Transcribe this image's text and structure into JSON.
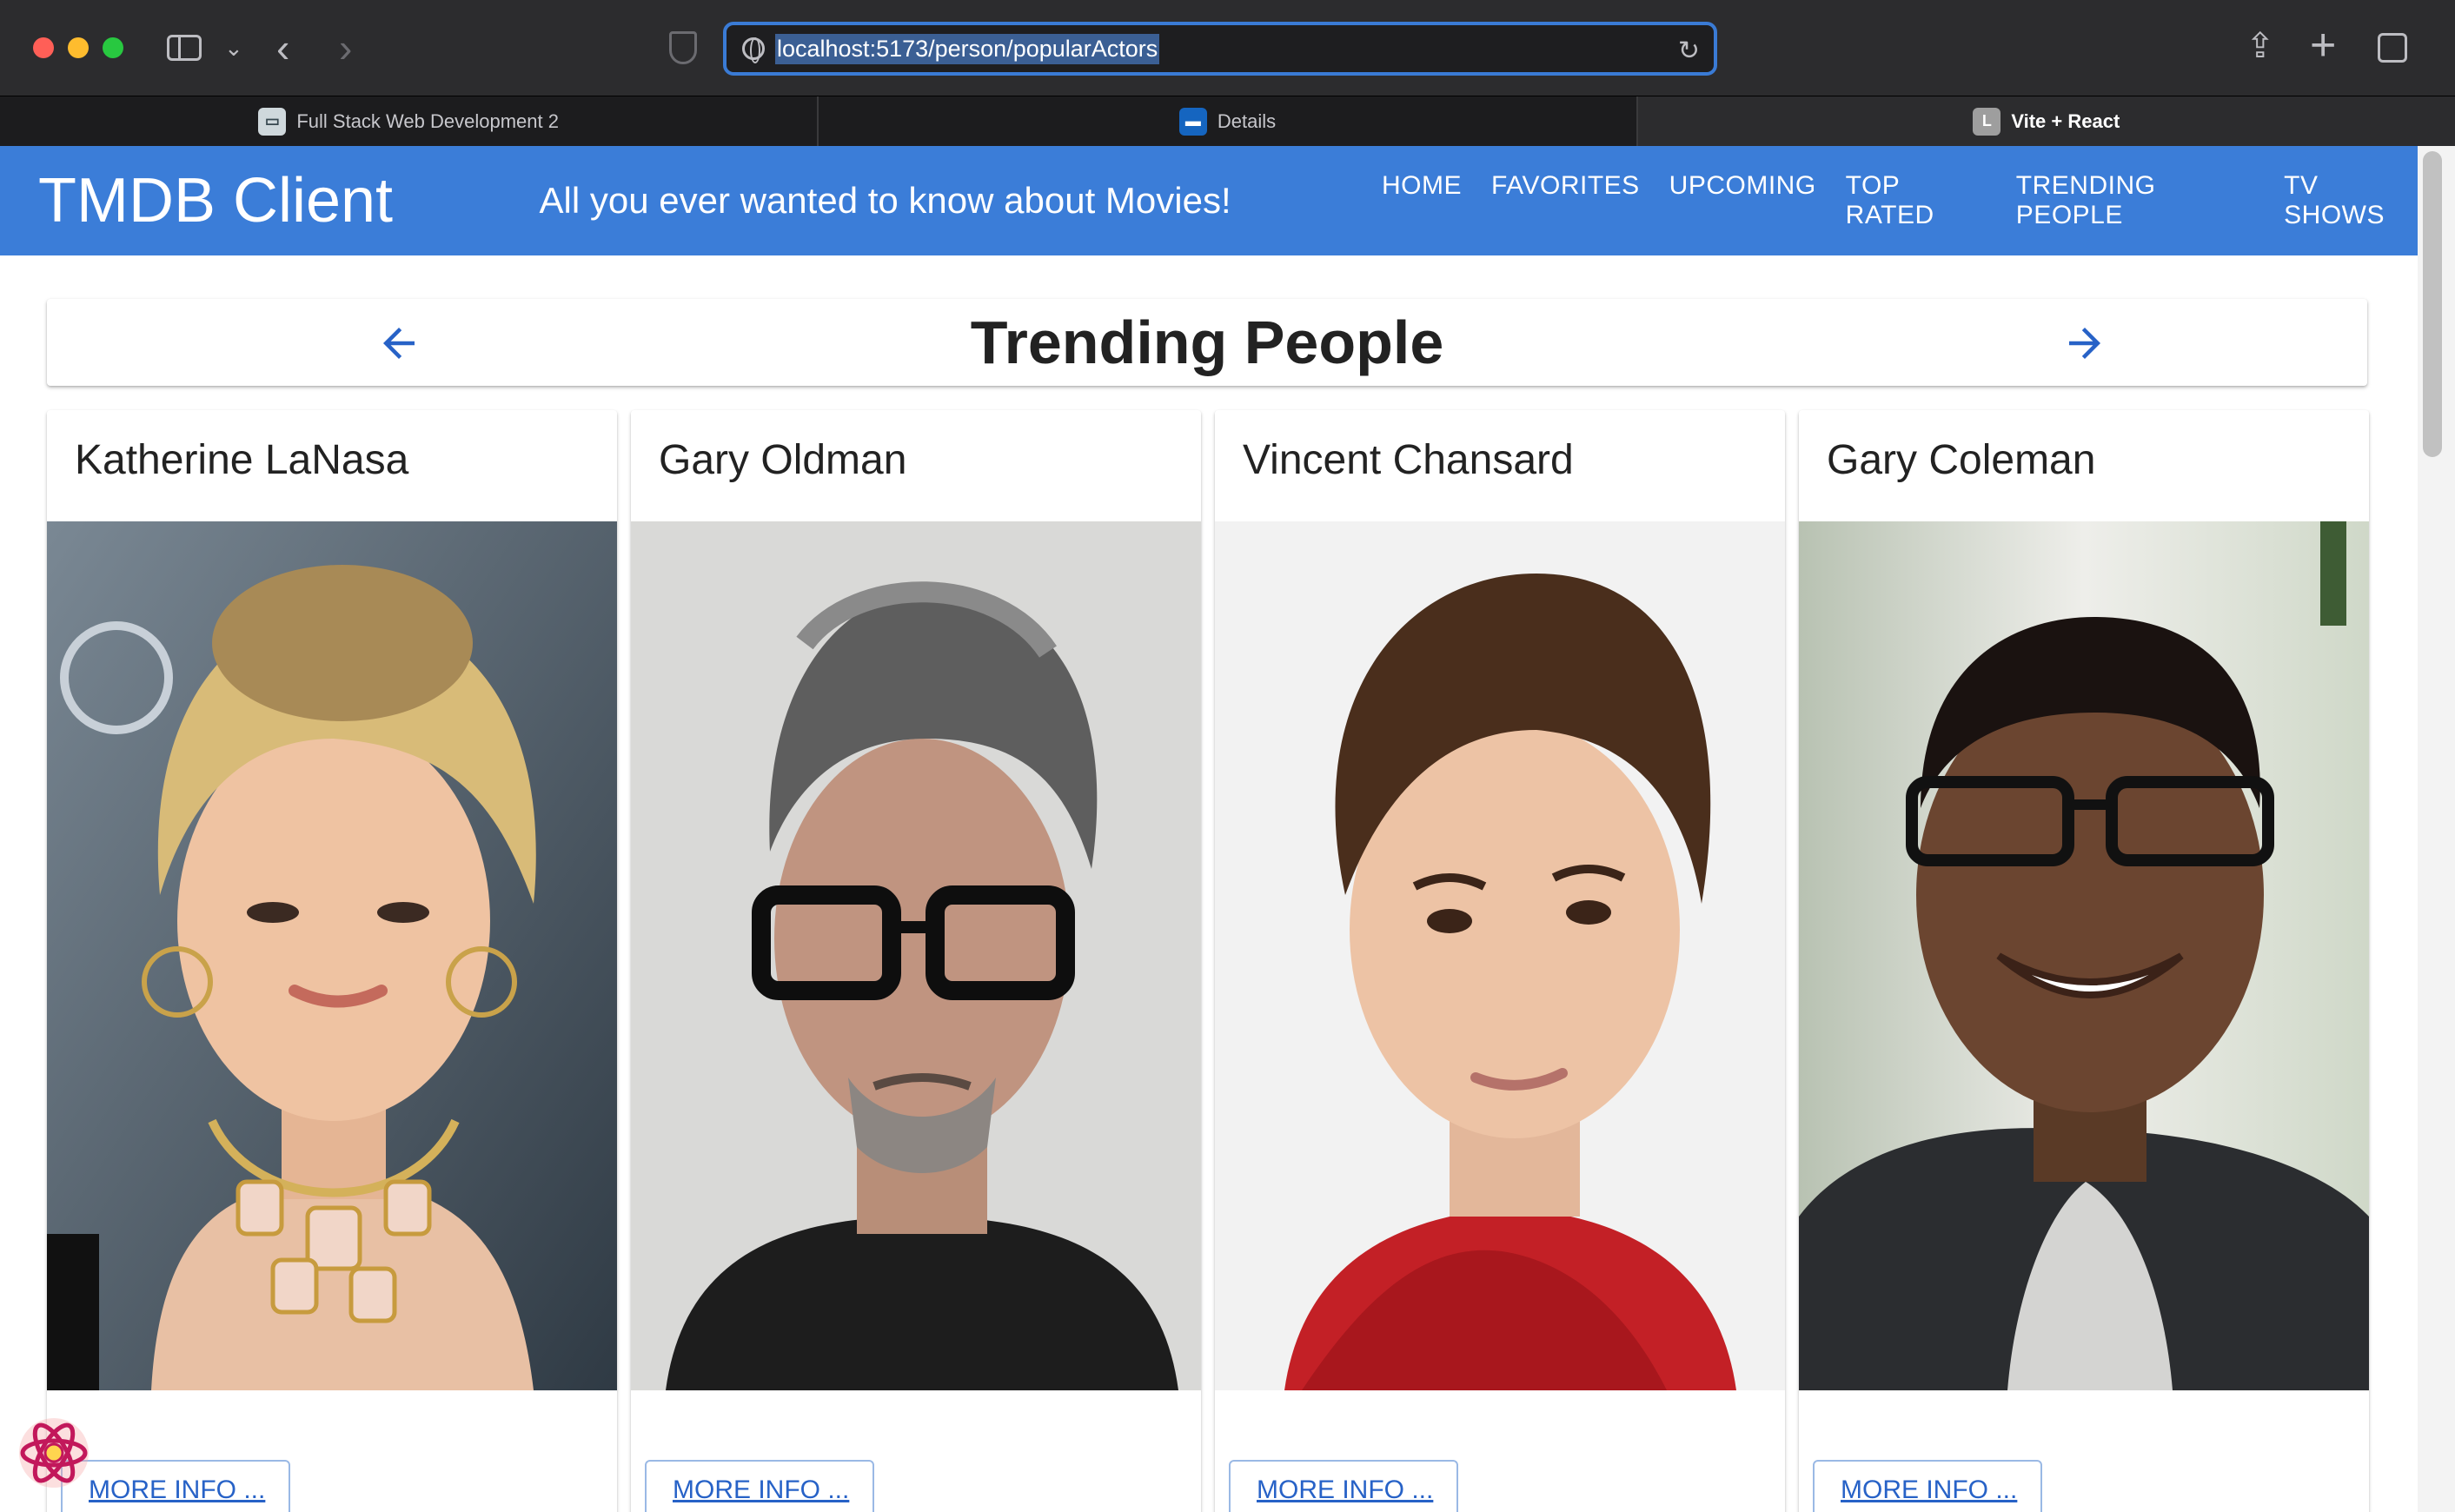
{
  "browser": {
    "url": "localhost:5173/person/popularActors",
    "tabs": [
      {
        "label": "Full Stack Web Development 2",
        "favicon": "browser-tab-icon"
      },
      {
        "label": "Details",
        "favicon": "app-tab-icon"
      },
      {
        "label": "Vite + React",
        "favicon_letter": "L",
        "active": true
      }
    ]
  },
  "app": {
    "brand": "TMDB Client",
    "tagline": "All you ever wanted to know about Movies!",
    "nav": [
      "HOME",
      "FAVORITES",
      "UPCOMING",
      "TOP RATED",
      "TRENDING PEOPLE",
      "TV SHOWS"
    ],
    "accent": "#3b7dd8"
  },
  "page": {
    "title": "Trending People",
    "people": [
      {
        "name": "Katherine LaNasa",
        "more_label": "MORE INFO ..."
      },
      {
        "name": "Gary Oldman",
        "more_label": "MORE INFO ..."
      },
      {
        "name": "Vincent Chansard",
        "more_label": "MORE INFO ..."
      },
      {
        "name": "Gary Coleman",
        "more_label": "MORE INFO ..."
      }
    ]
  }
}
